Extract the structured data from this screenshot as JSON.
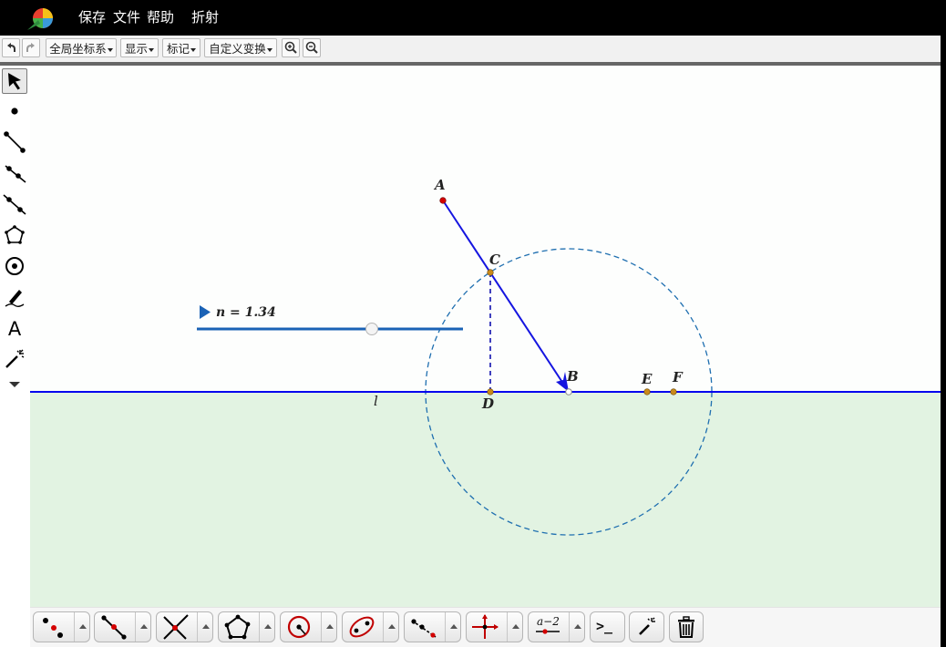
{
  "menu": {
    "items": [
      "保存",
      "文件",
      "帮助"
    ],
    "title": "折射"
  },
  "toolbar": {
    "undo_icon": "undo-icon",
    "redo_icon": "redo-icon",
    "coordinate_label": "全局坐标系",
    "display_label": "显示",
    "mark_label": "标记",
    "transform_label": "自定义变换",
    "zoom_in_icon": "zoom-in-icon",
    "zoom_out_icon": "zoom-out-icon"
  },
  "left_tools": [
    "select-arrow-icon",
    "point-icon",
    "segment-icon",
    "ray-icon",
    "line-icon",
    "polygon-icon",
    "circle-icon",
    "pen-icon",
    "text-icon",
    "magic-wand-icon",
    "more-icon"
  ],
  "canvas": {
    "slider": {
      "label": "n = 1.34",
      "value": 1.34
    },
    "points": {
      "A": "A",
      "B": "B",
      "C": "C",
      "D": "D",
      "E": "E",
      "F": "F"
    },
    "line_label": "l",
    "colors": {
      "line": "#0000ee",
      "ray": "#1515e0",
      "circle": "#1f6fb0",
      "lower_region": "#e1f3e1",
      "point_red": "#d40000",
      "point_orange": "#c98a1a"
    }
  },
  "bottom_tools": {
    "formula_label": "a−2",
    "terminal_label": ">_"
  }
}
